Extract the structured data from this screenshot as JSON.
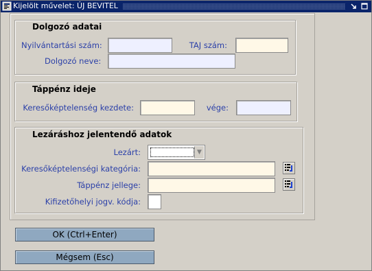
{
  "window": {
    "title": "Kijelölt művelet: ÚJ BEVITEL"
  },
  "groups": {
    "employee": {
      "title": "Dolgozó adatai",
      "reg_no_label": "Nyilvántartási szám:",
      "taj_label": "TAJ szám:",
      "name_label": "Dolgozó neve:",
      "reg_no_value": "",
      "taj_value": "",
      "name_value": ""
    },
    "sick_pay_period": {
      "title": "Táppénz ideje",
      "start_label": "Keresőképtelenség kezdete:",
      "end_label": "vége:",
      "start_value": "",
      "end_value": ""
    },
    "closing": {
      "title": "Lezáráshoz jelentendő adatok",
      "closed_label": "Lezárt:",
      "closed_value": "",
      "category_label": "Keresőképtelenségi kategória:",
      "category_value": "",
      "nature_label": "Táppénz jellege:",
      "nature_value": "",
      "legal_code_label": "Kifizetőhelyi jogv. kódja:",
      "legal_code_value": ""
    }
  },
  "buttons": {
    "ok": "OK (Ctrl+Enter)",
    "cancel": "Mégsem (Esc)"
  },
  "icons": {
    "window_icon": "form-icon",
    "lov_icon": "list-of-values-icon",
    "minimize": "minimize-icon",
    "maximize": "maximize-icon",
    "close": "close-icon"
  },
  "colors": {
    "titlebar": "#0a246a",
    "label_blue": "#2a3fa8",
    "field_blue": "#eef0ff",
    "field_yellow": "#fff8e7",
    "button": "#8fa8c0"
  }
}
